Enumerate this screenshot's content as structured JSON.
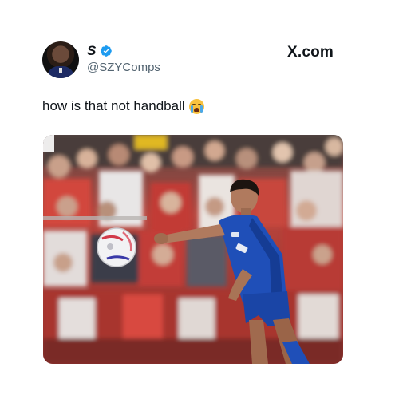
{
  "tweet": {
    "display_name": "S",
    "handle": "@SZYComps",
    "brand": "X.com",
    "text": "how is that not handball",
    "emoji_icon": "loudly-crying-face-emoji",
    "verified_icon": "verified-badge-icon",
    "verified_color": "#1d9bf0"
  },
  "media": {
    "kind": "video-frame",
    "subject": "football player in blue kit reaching toward a white ball in front of a crowd",
    "colors": {
      "crowd": "#b8443c",
      "kit": "#1f4fb8",
      "ball": "#f2f2f4"
    }
  }
}
